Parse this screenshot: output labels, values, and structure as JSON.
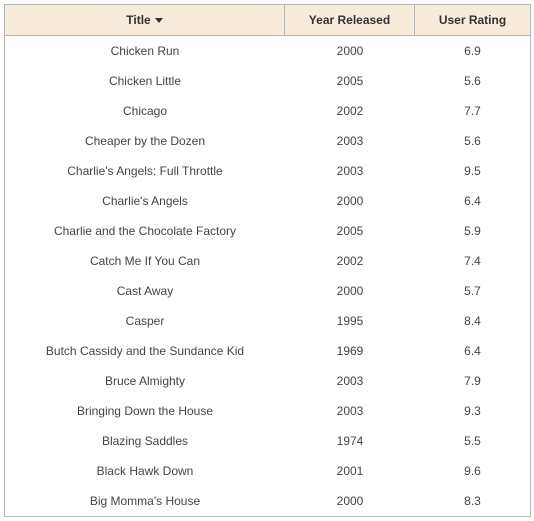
{
  "columns": {
    "title": "Title",
    "year": "Year Released",
    "rating": "User Rating"
  },
  "sort": {
    "column": "title",
    "direction": "desc"
  },
  "rows": [
    {
      "title": "Chicken Run",
      "year": "2000",
      "rating": "6.9"
    },
    {
      "title": "Chicken Little",
      "year": "2005",
      "rating": "5.6"
    },
    {
      "title": "Chicago",
      "year": "2002",
      "rating": "7.7"
    },
    {
      "title": "Cheaper by the Dozen",
      "year": "2003",
      "rating": "5.6"
    },
    {
      "title": "Charlie's Angels: Full Throttle",
      "year": "2003",
      "rating": "9.5"
    },
    {
      "title": "Charlie's Angels",
      "year": "2000",
      "rating": "6.4"
    },
    {
      "title": "Charlie and the Chocolate Factory",
      "year": "2005",
      "rating": "5.9"
    },
    {
      "title": "Catch Me If You Can",
      "year": "2002",
      "rating": "7.4"
    },
    {
      "title": "Cast Away",
      "year": "2000",
      "rating": "5.7"
    },
    {
      "title": "Casper",
      "year": "1995",
      "rating": "8.4"
    },
    {
      "title": "Butch Cassidy and the Sundance Kid",
      "year": "1969",
      "rating": "6.4"
    },
    {
      "title": "Bruce Almighty",
      "year": "2003",
      "rating": "7.9"
    },
    {
      "title": "Bringing Down the House",
      "year": "2003",
      "rating": "9.3"
    },
    {
      "title": "Blazing Saddles",
      "year": "1974",
      "rating": "5.5"
    },
    {
      "title": "Black Hawk Down",
      "year": "2001",
      "rating": "9.6"
    },
    {
      "title": "Big Momma's House",
      "year": "2000",
      "rating": "8.3"
    }
  ]
}
